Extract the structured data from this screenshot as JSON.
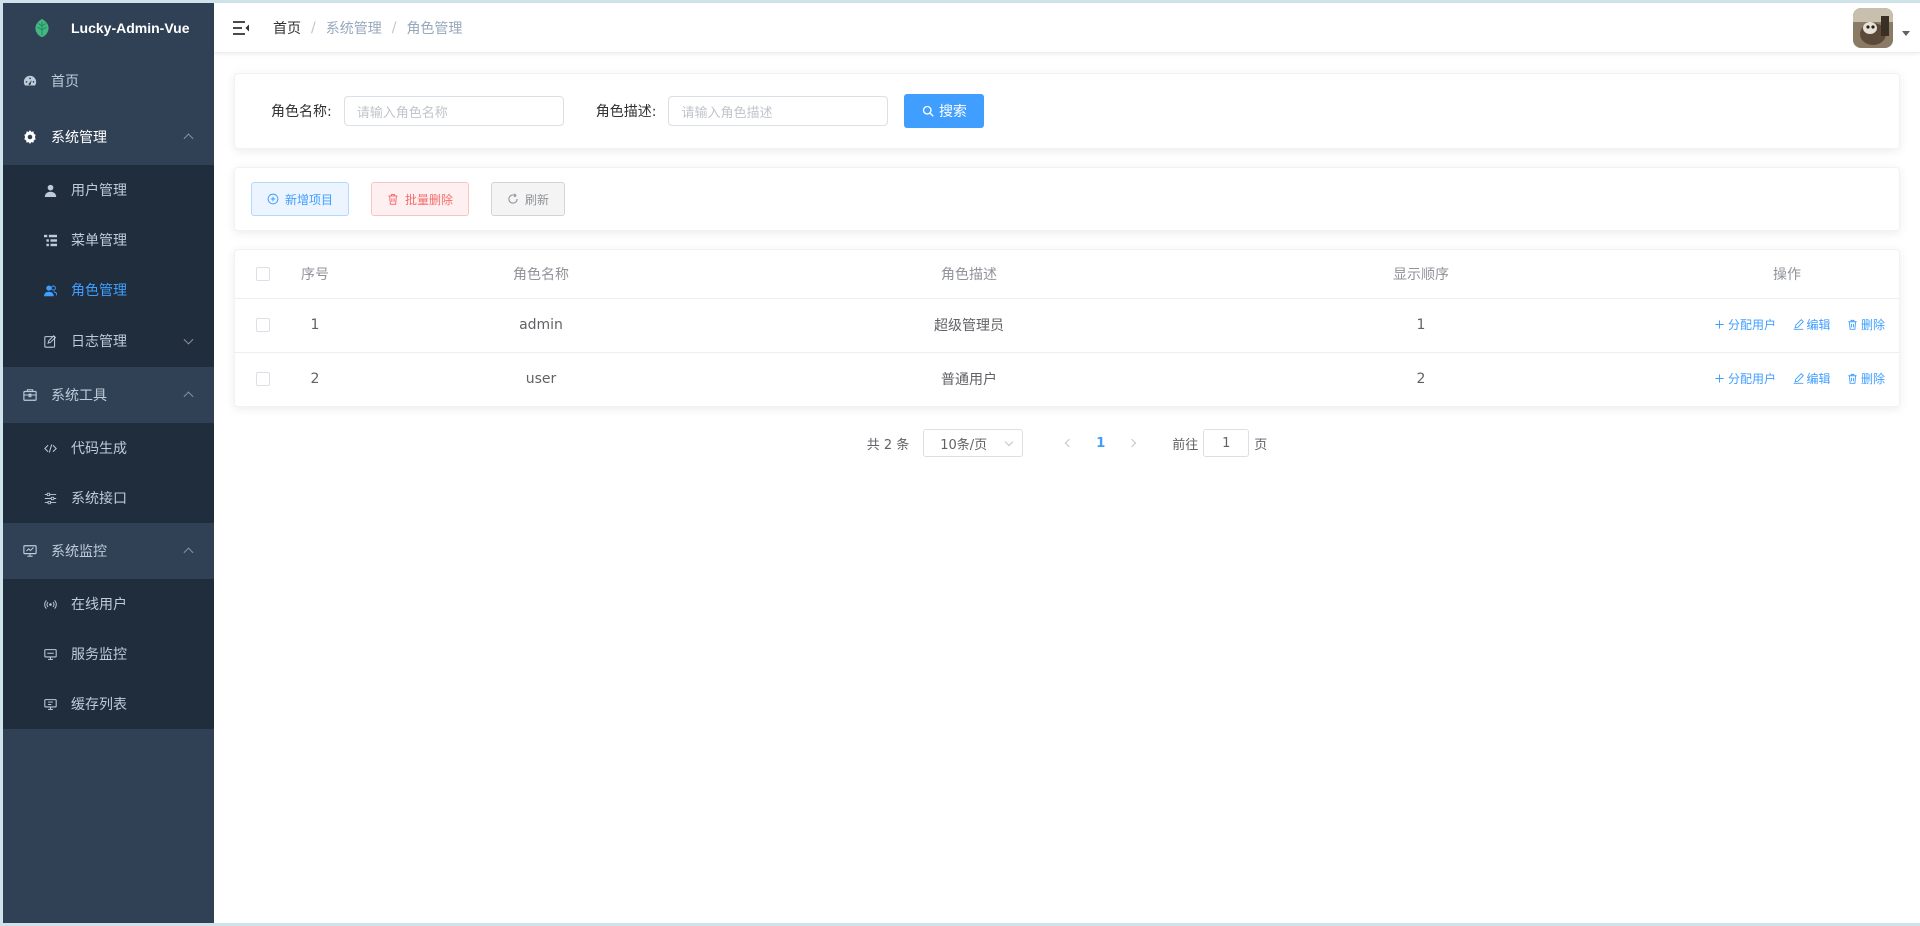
{
  "app": {
    "title": "Lucky-Admin-Vue"
  },
  "sidebar": {
    "home": "首页",
    "system": {
      "label": "系统管理",
      "items": [
        "用户管理",
        "菜单管理",
        "角色管理",
        "日志管理"
      ]
    },
    "tools": {
      "label": "系统工具",
      "items": [
        "代码生成",
        "系统接口"
      ]
    },
    "monitor": {
      "label": "系统监控",
      "items": [
        "在线用户",
        "服务监控",
        "缓存列表"
      ]
    }
  },
  "breadcrumb": [
    "首页",
    "系统管理",
    "角色管理"
  ],
  "search": {
    "name_label": "角色名称:",
    "name_placeholder": "请输入角色名称",
    "desc_label": "角色描述:",
    "desc_placeholder": "请输入角色描述",
    "button": "搜索"
  },
  "toolbar": {
    "add": "新增项目",
    "batch_delete": "批量删除",
    "refresh": "刷新"
  },
  "table": {
    "headers": [
      "序号",
      "角色名称",
      "角色描述",
      "显示顺序",
      "操作"
    ],
    "rows": [
      {
        "index": "1",
        "name": "admin",
        "desc": "超级管理员",
        "order": "1"
      },
      {
        "index": "2",
        "name": "user",
        "desc": "普通用户",
        "order": "2"
      }
    ],
    "ops": {
      "assign": "分配用户",
      "edit": "编辑",
      "delete": "删除"
    }
  },
  "pagination": {
    "total": "共 2 条",
    "page_size": "10条/页",
    "current": "1",
    "goto_prefix": "前往",
    "goto_value": "1",
    "goto_suffix": "页"
  },
  "colors": {
    "primary": "#409eff",
    "sidebar": "#304156",
    "submenu": "#1f2d3d",
    "danger": "#f56c6c"
  }
}
